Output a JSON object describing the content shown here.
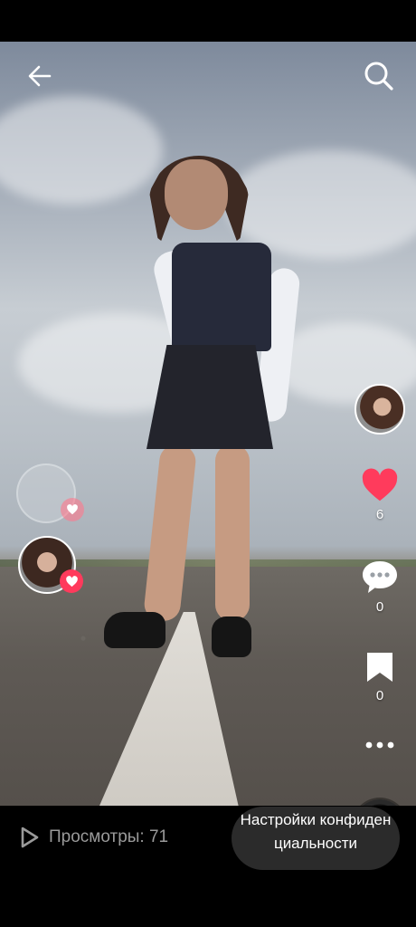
{
  "icons": {
    "back": "arrow-left-icon",
    "search": "search-icon",
    "like": "heart-icon",
    "comment": "comment-icon",
    "save": "bookmark-icon",
    "more": "more-dots-icon",
    "views": "play-icon"
  },
  "colors": {
    "like_red": "#ff3b5c",
    "bar_background": "#000000",
    "button_background": "#2b2b2b"
  },
  "actions": {
    "likes": "6",
    "comments": "0",
    "saves": "0"
  },
  "footer": {
    "views_label": "Просмотры: 71",
    "privacy_button": "Настройки конфиденциальности"
  }
}
